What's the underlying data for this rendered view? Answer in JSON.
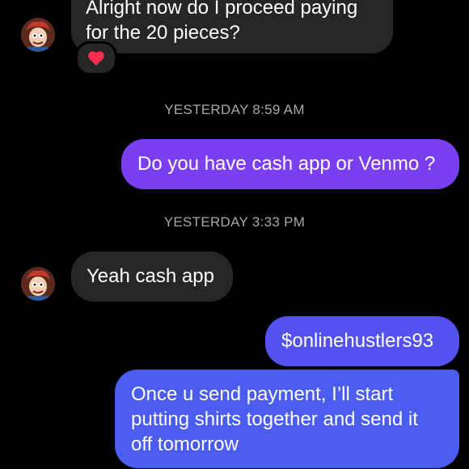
{
  "thread": {
    "messages": [
      {
        "id": "m1",
        "text_lines": [
          "Alright now do I proceed paying",
          "for the 20 pieces?"
        ],
        "reaction": "❤️"
      },
      {
        "id": "t1",
        "timestamp": "YESTERDAY 8:59 AM"
      },
      {
        "id": "m2",
        "text": "Do you have cash app or Venmo ?"
      },
      {
        "id": "t2",
        "timestamp": "YESTERDAY 3:33 PM"
      },
      {
        "id": "m3",
        "text": "Yeah cash app"
      },
      {
        "id": "m4",
        "text": "$onlinehustlers93"
      },
      {
        "id": "m5",
        "text_lines": [
          "Once u send payment, I’ll start",
          "putting shirts together and send it",
          "off tomorrow"
        ]
      }
    ]
  },
  "colors": {
    "background": "#000000",
    "incoming_bubble": "#262626",
    "outgoing_purple": "#7a3ff0",
    "outgoing_blue": "#4b5cf0",
    "timestamp_text": "#a8a8a8",
    "reaction_heart": "#ff2d4f"
  },
  "icons": {
    "contact_avatar": "cartoon-avatar-icon",
    "reaction": "heart-icon"
  }
}
